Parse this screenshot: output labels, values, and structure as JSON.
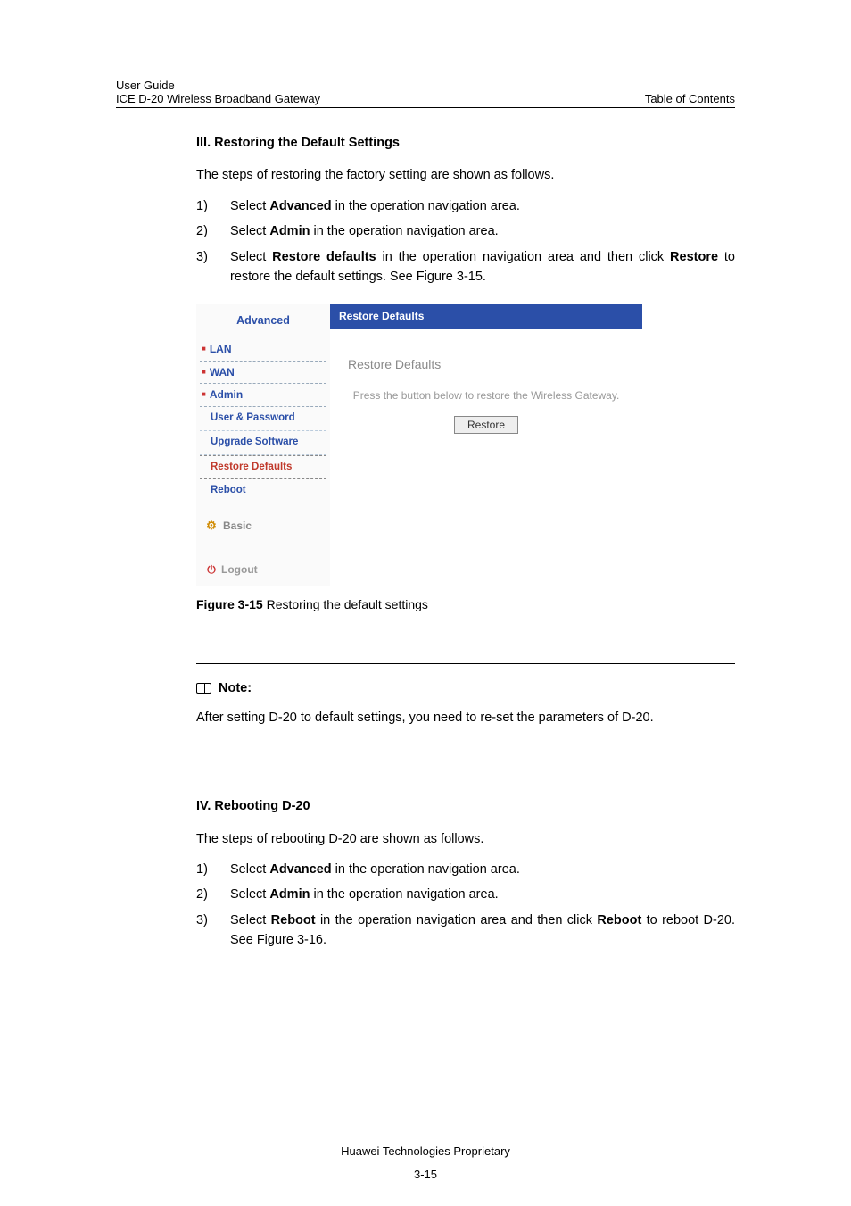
{
  "header": {
    "left_line1": "User Guide",
    "left_line2": "ICE D-20 Wireless Broadband Gateway",
    "right": "Table of Contents"
  },
  "section3": {
    "title": "III. Restoring the Default Settings",
    "intro": "The steps of restoring the factory setting are shown as follows.",
    "steps": [
      {
        "num": "1)",
        "pre": "Select ",
        "bold": "Advanced",
        "post": " in the operation navigation area."
      },
      {
        "num": "2)",
        "pre": "Select ",
        "bold": "Admin",
        "post": " in the operation navigation area."
      },
      {
        "num": "3)",
        "pre": "Select ",
        "bold": "Restore defaults",
        "mid": " in the operation navigation area and then click ",
        "bold2": "Restore",
        "post2": " to restore the default settings. See Figure 3-15."
      }
    ]
  },
  "figure": {
    "sidebar": {
      "title": "Advanced",
      "items": [
        {
          "label": "LAN"
        },
        {
          "label": "WAN"
        },
        {
          "label": "Admin"
        }
      ],
      "subitems": [
        {
          "label": "User & Password",
          "active": false
        },
        {
          "label": "Upgrade Software",
          "active": false
        },
        {
          "label": "Restore Defaults",
          "active": true
        },
        {
          "label": "Reboot",
          "active": false
        }
      ],
      "basic": "Basic",
      "logout": "Logout"
    },
    "main": {
      "header": "Restore Defaults",
      "title": "Restore Defaults",
      "text": "Press the button below to restore the Wireless Gateway.",
      "button": "Restore"
    },
    "caption_num": "Figure 3-15",
    "caption_text": " Restoring the default settings"
  },
  "note": {
    "label": "Note:",
    "text": "After setting D-20 to default settings, you need to re-set the parameters of D-20."
  },
  "section4": {
    "title": "IV. Rebooting D-20",
    "intro": "The steps of rebooting D-20 are shown as follows.",
    "steps": [
      {
        "num": "1)",
        "pre": "Select ",
        "bold": "Advanced",
        "post": " in the operation navigation area."
      },
      {
        "num": "2)",
        "pre": "Select ",
        "bold": "Admin",
        "post": " in the operation navigation area."
      },
      {
        "num": "3)",
        "pre": "Select ",
        "bold": "Reboot",
        "mid": " in the operation navigation area and then click ",
        "bold2": "Reboot",
        "post2": " to reboot D-20. See Figure 3-16."
      }
    ]
  },
  "footer": {
    "proprietary": "Huawei Technologies Proprietary",
    "page": "3-15"
  }
}
